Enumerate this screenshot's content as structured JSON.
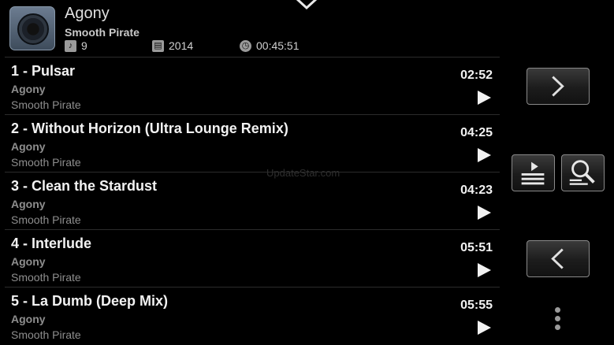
{
  "album": {
    "title": "Agony",
    "artist": "Smooth Pirate",
    "track_count": "9",
    "year": "2014",
    "duration": "00:45:51"
  },
  "tracks": [
    {
      "title": "1 - Pulsar",
      "album": "Agony",
      "artist": "Smooth Pirate",
      "time": "02:52"
    },
    {
      "title": "2 - Without Horizon (Ultra Lounge Remix)",
      "album": "Agony",
      "artist": "Smooth Pirate",
      "time": "04:25"
    },
    {
      "title": "3 - Clean the Stardust",
      "album": "Agony",
      "artist": "Smooth Pirate",
      "time": "04:23"
    },
    {
      "title": "4 - Interlude",
      "album": "Agony",
      "artist": "Smooth Pirate",
      "time": "05:51"
    },
    {
      "title": "5 - La Dumb (Deep Mix)",
      "album": "Agony",
      "artist": "Smooth Pirate",
      "time": "05:55"
    }
  ],
  "watermark": "UpdateStar.com",
  "icons": {
    "album_art": "speaker-album-art",
    "tracks": "music-note-icon",
    "year": "calendar-icon",
    "duration": "clock-icon",
    "collapse": "chevron-down-icon",
    "play": "play-icon",
    "next": "chevron-right-icon",
    "prev": "chevron-left-icon",
    "queue": "play-queue-icon",
    "search": "search-list-icon",
    "more": "more-vertical-icon"
  }
}
